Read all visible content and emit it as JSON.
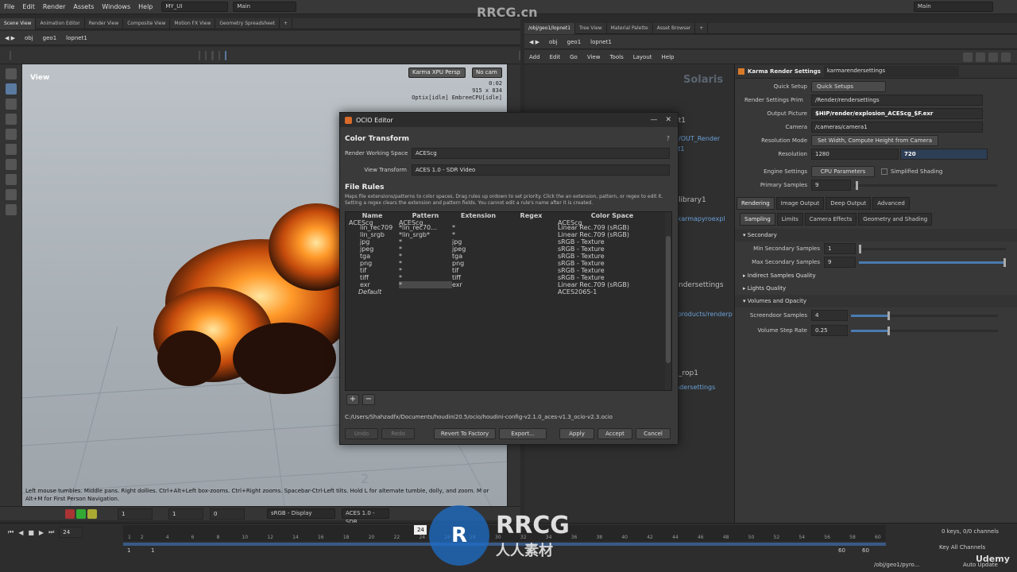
{
  "menubar": {
    "items": [
      "File",
      "Edit",
      "Render",
      "Assets",
      "Windows",
      "Help"
    ],
    "desktop": "MY_UI",
    "context": "Main",
    "right": "Main"
  },
  "left_tabs": [
    "Scene View",
    "Animation Editor",
    "Render View",
    "Composite View",
    "Motion FX View",
    "Geometry Spreadsheet"
  ],
  "left_path": [
    "obj",
    "geo1",
    "lopnet1"
  ],
  "right_tabs": [
    "/obj/geo1/lopnet1",
    "Tree View",
    "Material Palette",
    "Asset Browser"
  ],
  "right_path": [
    "obj",
    "geo1",
    "lopnet1"
  ],
  "net_menu": [
    "Add",
    "Edit",
    "Go",
    "View",
    "Tools",
    "Layout",
    "Help"
  ],
  "network": {
    "title": "Solaris",
    "nodes": [
      "rt1",
      "/OUT_Render",
      "rt1",
      "library1",
      "/karmapyroexpl",
      "ndersettings",
      "/products/renderp",
      "_rop1",
      "ndersettings"
    ]
  },
  "viewport": {
    "label": "View",
    "renderer": "Karma XPU Persp",
    "cam": "No cam",
    "stats": [
      "0:02",
      "915 x 834",
      "Optix[idle] EmbreeCPU[idle]"
    ],
    "grid_label": "2",
    "hint": "Left mouse tumbles. Middle pans. Right dollies. Ctrl+Alt+Left box-zooms. Ctrl+Right zooms. Spacebar-Ctrl-Left tilts. Hold L for alternate tumble, dolly, and zoom. M or Alt+M for First Person Navigation."
  },
  "viewport_bottom": {
    "f1": "1",
    "f2": "1",
    "f3": "0",
    "display": "sRGB - Display",
    "view": "ACES 1.0 - SDR"
  },
  "dialog": {
    "title": "OCIO Editor",
    "color_transform": "Color Transform",
    "rws_label": "Render Working Space",
    "rws_value": "ACEScg",
    "vt_label": "View Transform",
    "vt_value": "ACES 1.0 - SDR Video",
    "file_rules": "File Rules",
    "desc1": "Maps file extensions/patterns to color spaces. Drag rules up ordown to set priority. Click the an extension, pattern, or regex to edit it.",
    "desc2": "Setting a regex clears the extension and pattern fields. You cannot edit a rule's name after it is created.",
    "headers": [
      "Name",
      "Pattern",
      "Extension",
      "Regex",
      "Color Space"
    ],
    "rows": [
      {
        "name": "ACEScg",
        "pattern": "ACEScg",
        "ext": "",
        "regex": "",
        "cs": "ACEScg"
      },
      {
        "name": "lin_rec709",
        "pattern": "*lin_rec70…",
        "ext": "*",
        "regex": "",
        "cs": "Linear Rec.709 (sRGB)"
      },
      {
        "name": "lin_srgb",
        "pattern": "*lin_srgb*",
        "ext": "*",
        "regex": "",
        "cs": "Linear Rec.709 (sRGB)"
      },
      {
        "name": "jpg",
        "pattern": "*",
        "ext": "jpg",
        "regex": "",
        "cs": "sRGB - Texture"
      },
      {
        "name": "jpeg",
        "pattern": "*",
        "ext": "jpeg",
        "regex": "",
        "cs": "sRGB - Texture"
      },
      {
        "name": "tga",
        "pattern": "*",
        "ext": "tga",
        "regex": "",
        "cs": "sRGB - Texture"
      },
      {
        "name": "png",
        "pattern": "*",
        "ext": "png",
        "regex": "",
        "cs": "sRGB - Texture"
      },
      {
        "name": "tif",
        "pattern": "*",
        "ext": "tif",
        "regex": "",
        "cs": "sRGB - Texture"
      },
      {
        "name": "tiff",
        "pattern": "*",
        "ext": "tiff",
        "regex": "",
        "cs": "sRGB - Texture"
      },
      {
        "name": "exr",
        "pattern": "*",
        "ext": "exr",
        "regex": "",
        "cs": "Linear Rec.709 (sRGB)"
      },
      {
        "name": "Default",
        "pattern": "",
        "ext": "",
        "regex": "",
        "cs": "ACES2065-1"
      }
    ],
    "add": "+",
    "remove": "−",
    "path": "C:/Users/Shahzadfx/Documents/houdini20.5/ocio/houdini-config-v2.1.0_aces-v1.3_ocio-v2.3.ocio",
    "buttons": {
      "undo": "Undo",
      "redo": "Redo",
      "revert": "Revert To Factory",
      "export": "Export...",
      "apply": "Apply",
      "accept": "Accept",
      "cancel": "Cancel"
    }
  },
  "params": {
    "type": "Karma Render Settings",
    "name": "karmarendersettings",
    "quick_setup_label": "Quick Setup",
    "quick_setup": "Quick Setups",
    "prim_label": "Render Settings Prim",
    "prim": "/Render/rendersettings",
    "picture_label": "Output Picture",
    "picture": "$HIP/render/explosion_ACEScg_$F.exr",
    "camera_label": "Camera",
    "camera": "/cameras/camera1",
    "resmode_label": "Resolution Mode",
    "resmode": "Set Width, Compute Height from Camera",
    "res_label": "Resolution",
    "res_w": "1280",
    "res_h": "720",
    "engine_label": "Engine Settings",
    "engine": "CPU Parameters",
    "simplified": "Simplified Shading",
    "primary_label": "Primary Samples",
    "primary": "9",
    "tabs1": [
      "Rendering",
      "Image Output",
      "Deep Output",
      "Advanced"
    ],
    "tabs2": [
      "Sampling",
      "Limits",
      "Camera Effects",
      "Geometry and Shading"
    ],
    "secondary": "Secondary",
    "minsec_label": "Min Secondary Samples",
    "minsec": "1",
    "maxsec_label": "Max Secondary Samples",
    "maxsec": "9",
    "indirect": "Indirect Samples Quality",
    "light": "Lights Quality",
    "volumes": "Volumes and Opacity",
    "screendoor_label": "Screendoor Samples",
    "screendoor": "4",
    "step_label": "Volume Step Rate",
    "step": "0.25"
  },
  "timeline": {
    "frame": "24",
    "current": "24",
    "ticks": [
      "1",
      "2",
      "4",
      "6",
      "8",
      "10",
      "12",
      "14",
      "16",
      "18",
      "20",
      "22",
      "24",
      "26",
      "28",
      "30",
      "32",
      "34",
      "36",
      "38",
      "40",
      "42",
      "44",
      "46",
      "48",
      "50",
      "52",
      "54",
      "56",
      "58",
      "60"
    ],
    "start": "1",
    "start2": "1",
    "end": "60",
    "end2": "60",
    "keys": "0 keys, 0/0 channels",
    "keyall": "Key All Channels",
    "autoupdate": "Auto Update",
    "status_path": "/obj/geo1/pyro..."
  },
  "watermarks": {
    "site": "RRCG.cn",
    "logo1": "RRCG",
    "logo2": "人人素材",
    "udemy": "Udemy"
  }
}
